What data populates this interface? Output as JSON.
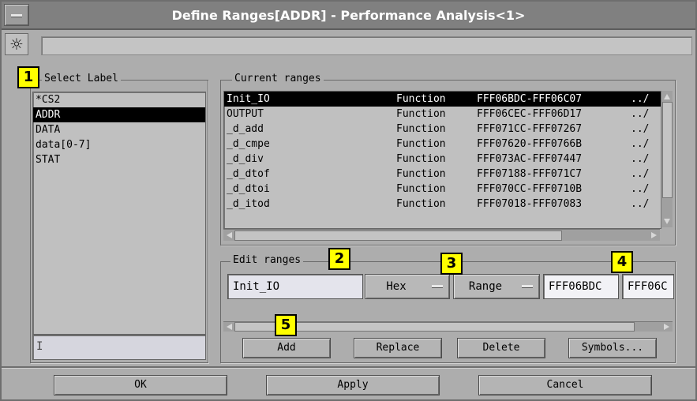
{
  "window": {
    "title": "Define Ranges[ADDR] - Performance Analysis<1>"
  },
  "toolbar": {
    "icon": "sun-icon",
    "field_value": ""
  },
  "callouts": [
    "1",
    "2",
    "3",
    "4",
    "5"
  ],
  "select_label": {
    "title": "Select Label",
    "items": [
      {
        "label": "*CS2",
        "selected": false
      },
      {
        "label": "ADDR",
        "selected": true
      },
      {
        "label": "DATA",
        "selected": false
      },
      {
        "label": "data[0-7]",
        "selected": false
      },
      {
        "label": "STAT",
        "selected": false
      }
    ],
    "input_value": ""
  },
  "current_ranges": {
    "title": "Current ranges",
    "rows": [
      {
        "name": "Init_IO",
        "type": "Function",
        "range": "FFF06BDC-FFF06C07",
        "more": "../",
        "selected": true
      },
      {
        "name": "OUTPUT",
        "type": "Function",
        "range": "FFF06CEC-FFF06D17",
        "more": "../",
        "selected": false
      },
      {
        "name": "_d_add",
        "type": "Function",
        "range": "FFF071CC-FFF07267",
        "more": "../",
        "selected": false
      },
      {
        "name": "_d_cmpe",
        "type": "Function",
        "range": "FFF07620-FFF0766B",
        "more": "../",
        "selected": false
      },
      {
        "name": "_d_div",
        "type": "Function",
        "range": "FFF073AC-FFF07447",
        "more": "../",
        "selected": false
      },
      {
        "name": "_d_dtof",
        "type": "Function",
        "range": "FFF07188-FFF071C7",
        "more": "../",
        "selected": false
      },
      {
        "name": "_d_dtoi",
        "type": "Function",
        "range": "FFF070CC-FFF0710B",
        "more": "../",
        "selected": false
      },
      {
        "name": "_d_itod",
        "type": "Function",
        "range": "FFF07018-FFF07083",
        "more": "../",
        "selected": false
      }
    ]
  },
  "edit_ranges": {
    "title": "Edit ranges",
    "name_value": "Init_IO",
    "base_select": "Hex",
    "mode_select": "Range",
    "start_value": "FFF06BDC",
    "end_value": "FFF06C",
    "buttons": {
      "add": "Add",
      "replace": "Replace",
      "delete": "Delete",
      "symbols": "Symbols..."
    }
  },
  "footer": {
    "ok": "OK",
    "apply": "Apply",
    "cancel": "Cancel"
  }
}
